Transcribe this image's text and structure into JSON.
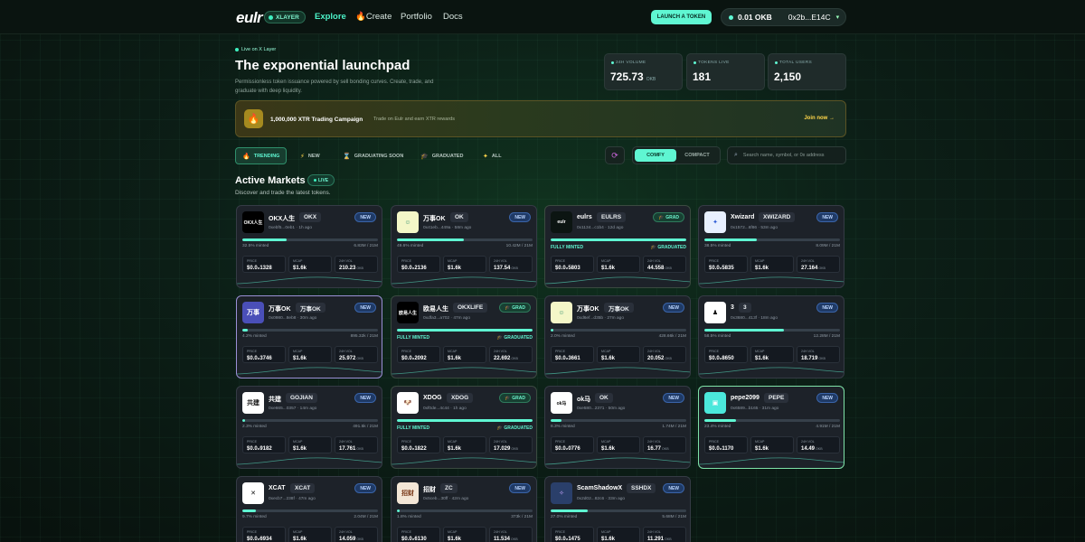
{
  "header": {
    "logo": "eulr",
    "network_badge": "XLAYER",
    "nav": [
      "Explore",
      "Create",
      "Portfolio",
      "Docs"
    ],
    "create_icon": "fire-icon",
    "launch_button": "LAUNCH A TOKEN",
    "wallet": {
      "balance": "0.01 OKB",
      "address": "0x2b...E14C"
    }
  },
  "hero": {
    "live_tag": "Live on X Layer",
    "title": "The exponential launchpad",
    "subtitle": "Permissionless token issuance powered by sell bonding curves. Create, trade, and graduate with deep liquidity."
  },
  "stats": [
    {
      "label": "24H VOLUME",
      "value": "725.73",
      "unit": "OKB"
    },
    {
      "label": "TOKENS LIVE",
      "value": "181",
      "unit": ""
    },
    {
      "label": "TOTAL USERS",
      "value": "2,150",
      "unit": ""
    }
  ],
  "campaign": {
    "title": "1,000,000 XTR Trading Campaign",
    "subtitle": "Trade on Eulr and earn XTR rewards",
    "cta": "Join now →"
  },
  "filters": [
    "TRENDING",
    "NEW",
    "GRADUATING SOON",
    "GRADUATED",
    "ALL"
  ],
  "view": {
    "comfy": "COMFY",
    "compact": "COMPACT"
  },
  "search": {
    "placeholder": "Search name, symbol, or 0x address"
  },
  "section": {
    "title": "Active Markets",
    "badge": "LIVE",
    "subtitle": "Discover and trade the latest tokens."
  },
  "labels": {
    "price": "PRICE",
    "mcap": "MCAP",
    "vol": "24H VOL",
    "unit": "OKB",
    "minted": "minted",
    "fully_minted": "FULLY MINTED",
    "graduated": "GRADUATED",
    "new": "NEW",
    "grad": "GRAD"
  },
  "colors": {
    "accent": "#5ff6d2",
    "card_bg": "#1d2229",
    "new_badge": "#1f3a66",
    "grad_badge": "#174032"
  },
  "tokens": [
    {
      "name": "OKX人生",
      "symbol": "OKX",
      "meta": "0xebf5...0eb1 · 1h ago",
      "status": "new",
      "progress": 0.325,
      "minted": "32.5% minted",
      "supply": "6.83M / 21M",
      "price": "$0.0₂1328",
      "mcap": "$1.6k",
      "vol": "210.23",
      "avatar": "OKX人生",
      "av_bg": "#000000",
      "av_fg": "#ffffff"
    },
    {
      "name": "万事OK",
      "symbol": "OK",
      "meta": "0x41eb...449a · 58m ago",
      "status": "new",
      "progress": 0.496,
      "minted": "49.6% minted",
      "supply": "10.42M / 21M",
      "price": "$0.0₂2136",
      "mcap": "$1.6k",
      "vol": "137.54",
      "avatar": "☺",
      "av_bg": "#f4f7c8",
      "av_fg": "#2a8a6a"
    },
    {
      "name": "eulrs",
      "symbol": "EULRS",
      "meta": "0x1134...c1b4 · 12d ago",
      "status": "grad",
      "progress": 1.0,
      "minted": "FULLY MINTED",
      "supply": "GRADUATED",
      "price": "$0.0₂5803",
      "mcap": "$1.6k",
      "vol": "44.558",
      "avatar": "eulr",
      "av_bg": "#0c1512",
      "av_fg": "#ffffff"
    },
    {
      "name": "Xwizard",
      "symbol": "XWIZARD",
      "meta": "0x1572...6f86 · 53m ago",
      "status": "new",
      "progress": 0.385,
      "minted": "38.5% minted",
      "supply": "8.09M / 21M",
      "price": "$0.0₂5835",
      "mcap": "$1.6k",
      "vol": "27.164",
      "avatar": "✦",
      "av_bg": "#e8f0ff",
      "av_fg": "#2d5bd6"
    },
    {
      "name": "万事OK",
      "symbol": "万事OK",
      "meta": "0x0980...8eb8 · 30m ago",
      "status": "new",
      "progress": 0.042,
      "minted": "4.2% minted",
      "supply": "895.32k / 21M",
      "price": "$0.0₂3746",
      "mcap": "$1.6k",
      "vol": "25.972",
      "avatar": "万事",
      "av_bg": "#4a4fb8",
      "av_fg": "#ffffff"
    },
    {
      "name": "欧易人生",
      "symbol": "OKXLIFE",
      "meta": "0xdfa3...a702 · 47m ago",
      "status": "grad",
      "progress": 1.0,
      "minted": "FULLY MINTED",
      "supply": "GRADUATED",
      "price": "$0.0₂2092",
      "mcap": "$1.6k",
      "vol": "22.692",
      "avatar": "欧易人生",
      "av_bg": "#000000",
      "av_fg": "#ffffff"
    },
    {
      "name": "万事OK",
      "symbol": "万事OK",
      "meta": "0xd6ef...d35b · 27m ago",
      "status": "new",
      "progress": 0.02,
      "minted": "2.0% minted",
      "supply": "428.66k / 21M",
      "price": "$0.0₂3661",
      "mcap": "$1.6k",
      "vol": "20.052",
      "avatar": "☺",
      "av_bg": "#f4f7c8",
      "av_fg": "#2a8a6a"
    },
    {
      "name": "3",
      "symbol": "3",
      "meta": "0x3680...413f · 18m ago",
      "status": "new",
      "progress": 0.585,
      "minted": "58.5% minted",
      "supply": "12.28M / 21M",
      "price": "$0.0₂8650",
      "mcap": "$1.6k",
      "vol": "18.719",
      "avatar": "♟",
      "av_bg": "#ffffff",
      "av_fg": "#111111"
    },
    {
      "name": "共建",
      "symbol": "GOJIAN",
      "meta": "0xe665...0357 · 14m ago",
      "status": "new",
      "progress": 0.023,
      "minted": "2.3% minted",
      "supply": "491.5k / 21M",
      "price": "$0.0₂9182",
      "mcap": "$1.6k",
      "vol": "17.761",
      "avatar": "共建",
      "av_bg": "#ffffff",
      "av_fg": "#111111"
    },
    {
      "name": "XDOG",
      "symbol": "XDOG",
      "meta": "0xf0de...4c44 · 1h ago",
      "status": "grad",
      "progress": 1.0,
      "minted": "FULLY MINTED",
      "supply": "GRADUATED",
      "price": "$0.0₂1822",
      "mcap": "$1.6k",
      "vol": "17.029",
      "avatar": "🐶",
      "av_bg": "#ffffff",
      "av_fg": "#111111"
    },
    {
      "name": "ok马",
      "symbol": "OK",
      "meta": "0xe580...2371 · 50m ago",
      "status": "new",
      "progress": 0.083,
      "minted": "8.3% minted",
      "supply": "1.74M / 21M",
      "price": "$0.0₂0776",
      "mcap": "$1.6k",
      "vol": "16.77",
      "avatar": "ok马",
      "av_bg": "#ffffff",
      "av_fg": "#111111"
    },
    {
      "name": "pepe2099",
      "symbol": "PEPE",
      "meta": "0x6589...b165 · 31m ago",
      "status": "new",
      "progress": 0.234,
      "minted": "23.4% minted",
      "supply": "4.91M / 21M",
      "price": "$0.0₂1170",
      "mcap": "$1.6k",
      "vol": "14.49",
      "avatar": "▣",
      "av_bg": "#4be8dc",
      "av_fg": "#ffffff"
    },
    {
      "name": "XCAT",
      "symbol": "XCAT",
      "meta": "0xecb7...238f · 47m ago",
      "status": "new",
      "progress": 0.097,
      "minted": "9.7% minted",
      "supply": "2.04M / 21M",
      "price": "$0.0₂6934",
      "mcap": "$1.6k",
      "vol": "14.059",
      "avatar": "✕",
      "av_bg": "#ffffff",
      "av_fg": "#111111"
    },
    {
      "name": "招财",
      "symbol": "ZC",
      "meta": "0x5ceb...30ff · 42m ago",
      "status": "new",
      "progress": 0.018,
      "minted": "1.8% minted",
      "supply": "373k / 21M",
      "price": "$0.0₂6130",
      "mcap": "$1.6k",
      "vol": "11.534",
      "avatar": "招财",
      "av_bg": "#f3e6d6",
      "av_fg": "#7a3a1a"
    },
    {
      "name": "ScamShadowX",
      "symbol": "SSHDX",
      "meta": "0x2d02...82c6 · 33m ago",
      "status": "new",
      "progress": 0.27,
      "minted": "27.0% minted",
      "supply": "5.68M / 21M",
      "price": "$0.0₂1475",
      "mcap": "$1.6k",
      "vol": "11.291",
      "avatar": "✧",
      "av_bg": "#2a3f6a",
      "av_fg": "#c8a6ff"
    }
  ]
}
